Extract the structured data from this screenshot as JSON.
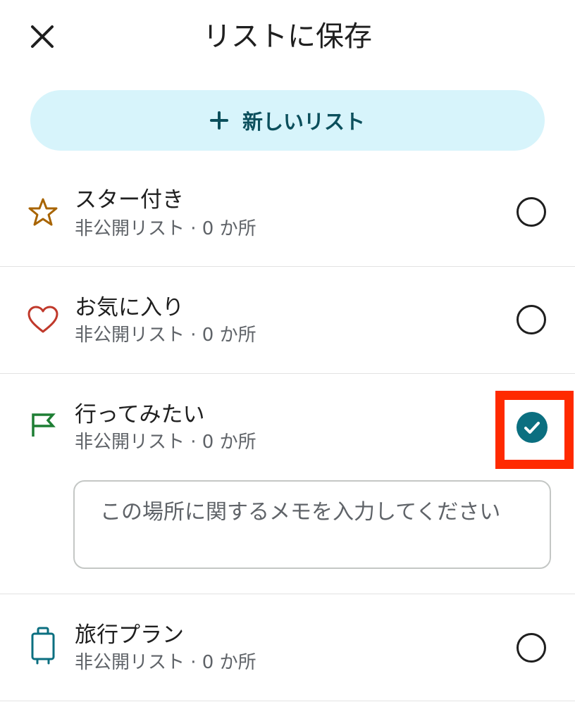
{
  "header": {
    "title": "リストに保存",
    "close_icon": "close-icon"
  },
  "new_list_button": {
    "label": "新しいリスト",
    "icon": "plus-icon",
    "bg_color": "#d7f4fb",
    "text_color": "#0b4f5c"
  },
  "lists": [
    {
      "name": "スター付き",
      "subtitle": "非公開リスト · 0 か所",
      "icon": "star-icon",
      "icon_color": "#a86400",
      "selected": false
    },
    {
      "name": "お気に入り",
      "subtitle": "非公開リスト · 0 か所",
      "icon": "heart-icon",
      "icon_color": "#c0392b",
      "selected": false
    },
    {
      "name": "行ってみたい",
      "subtitle": "非公開リスト · 0 か所",
      "icon": "flag-icon",
      "icon_color": "#1e7e34",
      "selected": true,
      "memo_placeholder": "この場所に関するメモを入力してください"
    },
    {
      "name": "旅行プラン",
      "subtitle": "非公開リスト · 0 か所",
      "icon": "suitcase-icon",
      "icon_color": "#0b6f80",
      "selected": false
    }
  ],
  "colors": {
    "check_fill": "#0b6f80",
    "highlight": "#ff2a00"
  }
}
